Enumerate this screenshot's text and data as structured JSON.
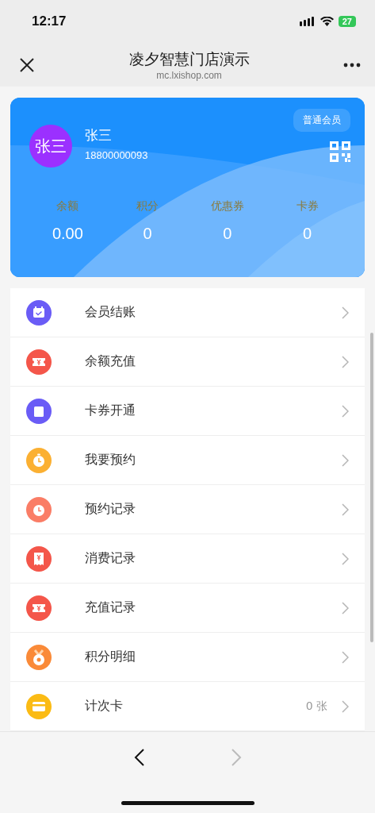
{
  "status_bar": {
    "time": "12:17",
    "battery": "27"
  },
  "nav": {
    "title": "凌夕智慧门店演示",
    "subtitle": "mc.lxishop.com"
  },
  "member_card": {
    "avatar_text": "张三",
    "name": "张三",
    "phone": "18800000093",
    "level_badge": "普通会员",
    "stats": [
      {
        "label": "余额",
        "value": "0.00"
      },
      {
        "label": "积分",
        "value": "0"
      },
      {
        "label": "优惠券",
        "value": "0"
      },
      {
        "label": "卡券",
        "value": "0"
      }
    ]
  },
  "menu": [
    {
      "label": "会员结账",
      "kind": "calendar",
      "color": "#6a5cf6"
    },
    {
      "label": "余额充值",
      "kind": "ticket",
      "color": "#f4564a"
    },
    {
      "label": "卡券开通",
      "kind": "bag",
      "color": "#6a5cf6"
    },
    {
      "label": "我要预约",
      "kind": "timer",
      "color": "#fbb032"
    },
    {
      "label": "预约记录",
      "kind": "clock",
      "color": "#fa7d66"
    },
    {
      "label": "消费记录",
      "kind": "receipt",
      "color": "#f4564a"
    },
    {
      "label": "充值记录",
      "kind": "ticket",
      "color": "#f4564a"
    },
    {
      "label": "积分明细",
      "kind": "medal",
      "color": "#fa8a38"
    },
    {
      "label": "计次卡",
      "kind": "card",
      "color": "#fbbb14",
      "value": "0 张"
    }
  ],
  "toolbar": {
    "back_disabled": false,
    "forward_disabled": true
  }
}
